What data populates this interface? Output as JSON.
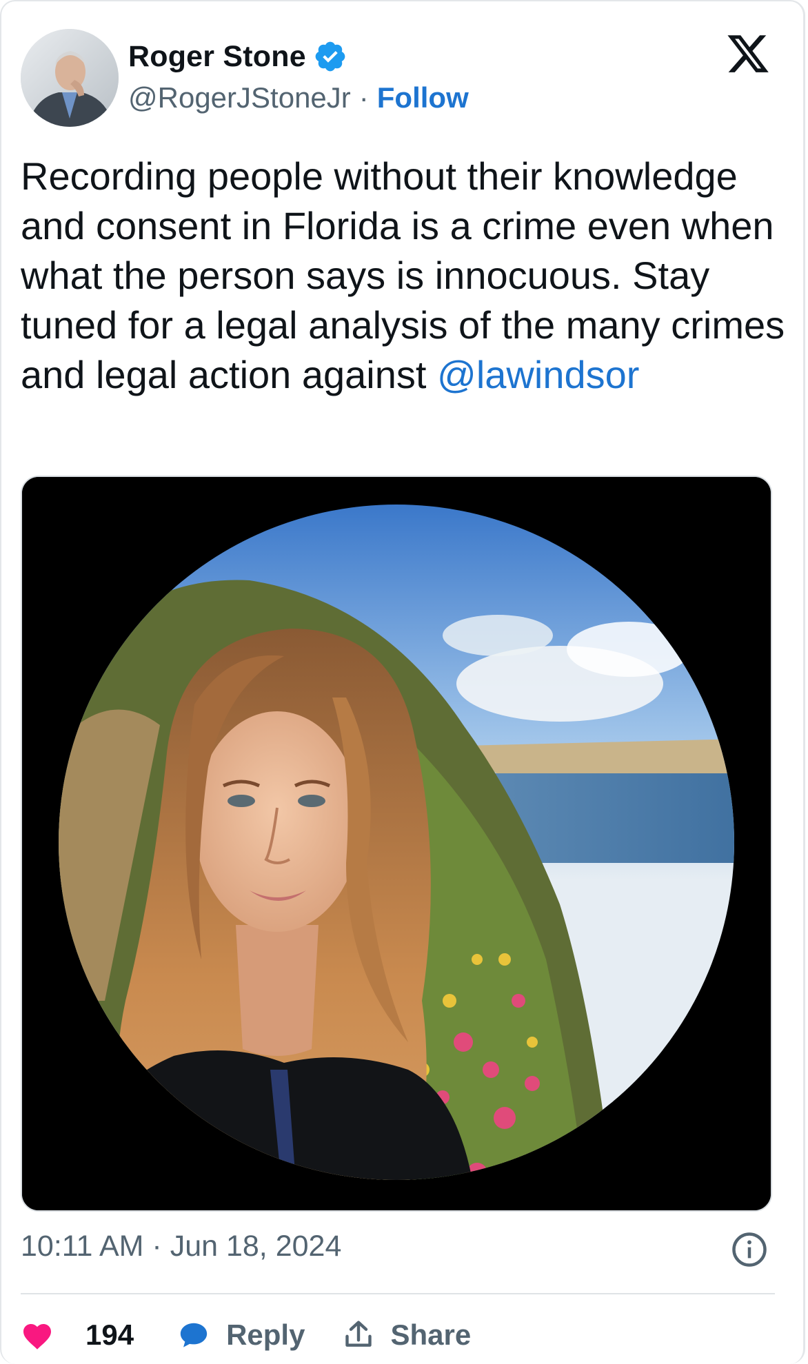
{
  "author": {
    "name": "Roger Stone",
    "handle": "@RogerJStoneJr",
    "separator": "·",
    "follow_label": "Follow",
    "verified_color": "#1d9bf0"
  },
  "platform": {
    "logo": "x-logo-icon"
  },
  "tweet": {
    "text": "Recording people without their knowledge and consent in Florida is a crime even when what the person says is innocuous. Stay tuned for a legal analysis of the many crimes and legal action against ",
    "mention": "@lawindsor"
  },
  "media": {
    "description_icon": "circular-profile-photo"
  },
  "meta": {
    "timestamp": "10:11 AM · Jun 18, 2024",
    "info_icon": "info-icon"
  },
  "actions": {
    "like_count": "194",
    "reply_label": "Reply",
    "share_label": "Share"
  },
  "colors": {
    "accent": "#1d74d0",
    "like": "#f91880",
    "muted": "#536471"
  }
}
